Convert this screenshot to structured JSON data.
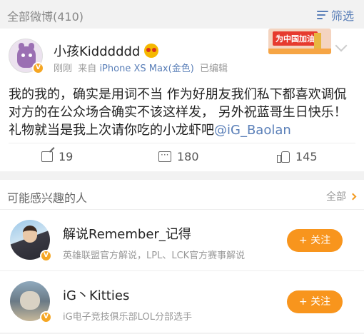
{
  "header": {
    "title": "全部微博(410)",
    "filter_label": "筛选"
  },
  "post": {
    "author": "小孩Kidddddd",
    "time": "刚刚",
    "source_prefix": "来自",
    "source": "iPhone XS Max(金色)",
    "edited": "已编辑",
    "badge_text": "为中国加油",
    "text_main": "我的我的，确实是用词不当 作为好朋友我们私下都喜欢调侃对方的在公众场合确实不该这样发， 另外祝蓝哥生日快乐！礼物就当是我上次请你吃的小龙虾吧",
    "mention": "@iG_Baolan",
    "shares": "19",
    "comments": "180",
    "likes": "145"
  },
  "suggestions": {
    "title": "可能感兴趣的人",
    "all_label": "全部",
    "people": [
      {
        "name": "解说Remember_记得",
        "desc": "英雄联盟官方解说，LPL、LCK官方赛事解说",
        "follow_label": "+ 关注"
      },
      {
        "name": "iG丶Kitties",
        "desc": "iG电子竞技俱乐部LOL分部选手",
        "follow_label": "+ 关注"
      }
    ]
  },
  "colors": {
    "link": "#5a7fb8",
    "accent_orange": "#f8951d",
    "verified": "#f5a623"
  }
}
